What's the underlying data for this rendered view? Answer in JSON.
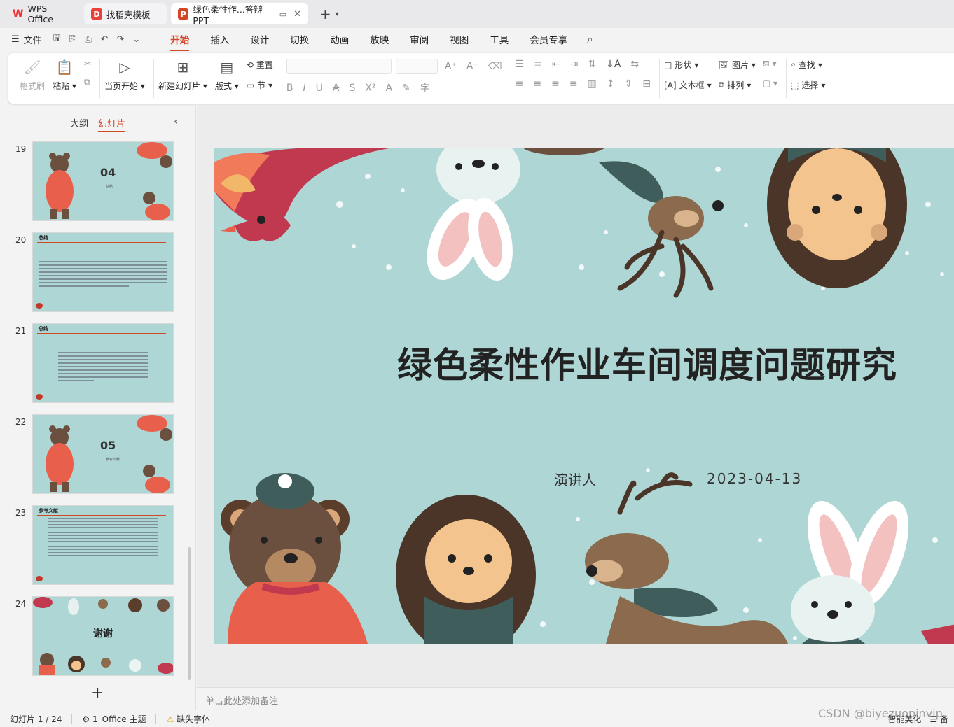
{
  "tabs": [
    {
      "label": "WPS Office"
    },
    {
      "label": "找稻壳模板"
    },
    {
      "label": "绿色柔性作...答辩PPT"
    }
  ],
  "menu": {
    "file_label": "文件",
    "tabs": [
      "开始",
      "插入",
      "设计",
      "切换",
      "动画",
      "放映",
      "审阅",
      "视图",
      "工具",
      "会员专享"
    ],
    "active_tab": "开始"
  },
  "ribbon": {
    "format_painter": "格式刷",
    "paste": "粘贴",
    "from_current": "当页开始",
    "new_slide": "新建幻灯片",
    "layout": "版式",
    "reset": "重置",
    "section": "节",
    "shape": "形状",
    "picture": "图片",
    "textbox": "文本框",
    "arrange": "排列",
    "find": "查找",
    "select": "选择"
  },
  "left_panel": {
    "tab_outline": "大纲",
    "tab_slides": "幻灯片",
    "thumbs": [
      {
        "num": "19",
        "big": "04",
        "sub": "总结"
      },
      {
        "num": "20",
        "header": "总结"
      },
      {
        "num": "21",
        "header": "总结"
      },
      {
        "num": "22",
        "big": "05",
        "sub": "参考文献"
      },
      {
        "num": "23",
        "header": "参考文献"
      },
      {
        "num": "24",
        "big": "谢谢"
      }
    ],
    "add_label": "+"
  },
  "slide": {
    "title": "绿色柔性作业车间调度问题研究",
    "presenter": "演讲人",
    "date": "2023-04-13"
  },
  "notes_placeholder": "单击此处添加备注",
  "status": {
    "slide_info": "幻灯片 1 / 24",
    "theme": "1_Office 主题",
    "missing_font": "缺失字体",
    "smart_beautify": "智能美化",
    "notes_btn": "备"
  },
  "watermark": "CSDN @biyezuopinvip",
  "colors": {
    "accent": "#d24726",
    "slide_bg": "#aed6d4"
  }
}
